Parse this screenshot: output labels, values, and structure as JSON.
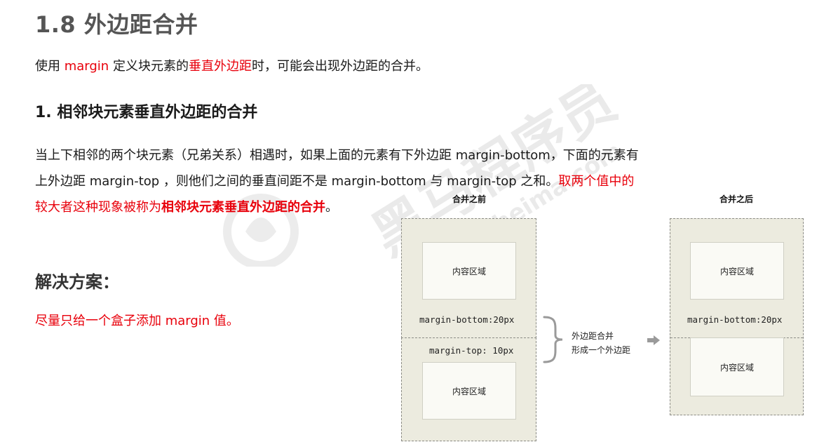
{
  "title": "1.8 外边距合并",
  "intro": {
    "part1": "使用 ",
    "highlight1": "margin",
    "part2": " 定义块元素的",
    "highlight2": "垂直外边距",
    "part3": "时，可能会出现外边距的合并。"
  },
  "section_heading": "1. 相邻块元素垂直外边距的合并",
  "paragraph": {
    "line1": "当上下相邻的两个块元素（兄弟关系）相遇时，如果上面的元素有下外边距 margin-bottom，下面的元素有",
    "line2_black": "上外边距 margin-top ，则他们之间的垂直间距不是 margin-bottom 与 margin-top 之和。",
    "line2_red": "取两个值中的",
    "line3_red": "较大者这种现象被称为",
    "line3_bold_red": "相邻块元素垂直外边距的合并",
    "line3_end": "。"
  },
  "solution": {
    "heading": "解决方案：",
    "text": "尽量只给一个盒子添加 margin 值。"
  },
  "diagram": {
    "before_caption": "合并之前",
    "after_caption": "合并之后",
    "content_label": "内容区域",
    "margin_bottom_label": "margin-bottom:20px",
    "margin_top_label": "margin-top: 10px",
    "note_line1": "外边距合并",
    "note_line2": "形成一个外边距"
  },
  "colors": {
    "highlight": "#e8000b",
    "title": "#555555",
    "box_background": "#ecebdf",
    "content_background": "#fafaf5"
  }
}
